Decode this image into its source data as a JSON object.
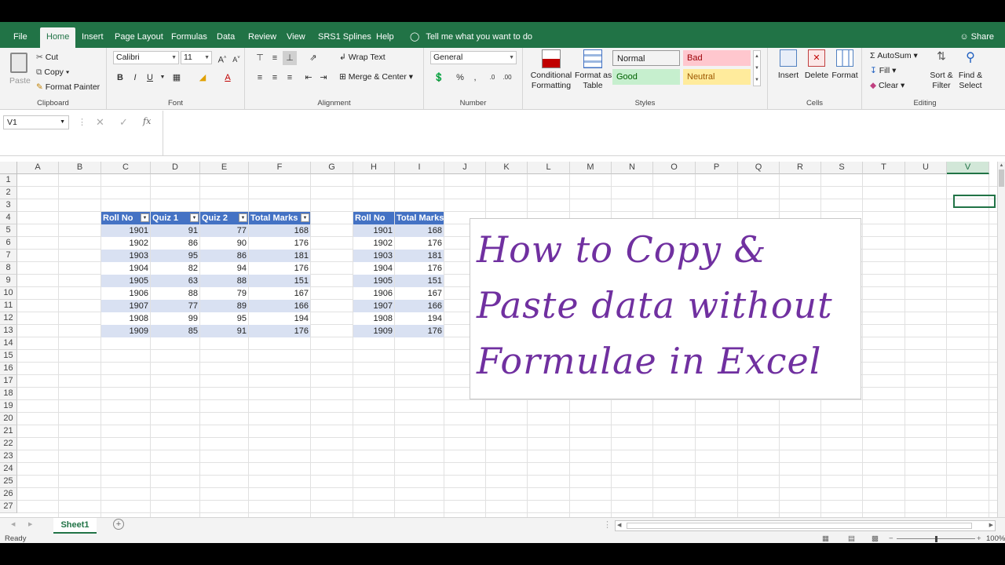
{
  "ribbon_tabs": [
    {
      "label": "File",
      "active": false
    },
    {
      "label": "Home",
      "active": true
    },
    {
      "label": "Insert",
      "active": false
    },
    {
      "label": "Page Layout",
      "active": false
    },
    {
      "label": "Formulas",
      "active": false
    },
    {
      "label": "Data",
      "active": false
    },
    {
      "label": "Review",
      "active": false
    },
    {
      "label": "View",
      "active": false
    },
    {
      "label": "SRS1 Splines",
      "active": false
    },
    {
      "label": "Help",
      "active": false
    }
  ],
  "tell_me": "Tell me what you want to do",
  "share": "Share",
  "clipboard": {
    "paste": "Paste",
    "cut": "Cut",
    "copy": "Copy",
    "format_painter": "Format Painter",
    "label": "Clipboard"
  },
  "font": {
    "name": "Calibri",
    "size": "11",
    "bold": "B",
    "italic": "I",
    "underline": "U",
    "label": "Font"
  },
  "alignment": {
    "wrap_text": "Wrap Text",
    "merge_center": "Merge & Center",
    "label": "Alignment"
  },
  "number": {
    "format": "General",
    "label": "Number"
  },
  "styles": {
    "conditional_formatting": [
      "Conditional",
      "Formatting"
    ],
    "format_as_table": [
      "Format as",
      "Table"
    ],
    "cells": [
      {
        "name": "Normal",
        "bg": "#ffffff",
        "fg": "#000000"
      },
      {
        "name": "Bad",
        "bg": "#ffc7ce",
        "fg": "#9c0006"
      },
      {
        "name": "Good",
        "bg": "#c6efce",
        "fg": "#006100"
      },
      {
        "name": "Neutral",
        "bg": "#ffeb9c",
        "fg": "#9c5700"
      }
    ],
    "label": "Styles"
  },
  "cells_group": {
    "insert": "Insert",
    "delete": "Delete",
    "format": "Format",
    "label": "Cells"
  },
  "editing": {
    "autosum": "AutoSum",
    "fill": "Fill",
    "clear": "Clear",
    "sort_filter": [
      "Sort &",
      "Filter"
    ],
    "find_select": [
      "Find &",
      "Select"
    ],
    "label": "Editing"
  },
  "name_box": "V1",
  "fx": "fx",
  "columns": [
    "A",
    "B",
    "C",
    "D",
    "E",
    "F",
    "G",
    "H",
    "I",
    "J",
    "K",
    "L",
    "M",
    "N",
    "O",
    "P",
    "Q",
    "R",
    "S",
    "T",
    "U",
    "V"
  ],
  "selected_column": "V",
  "rows": [
    "1",
    "2",
    "3",
    "4",
    "5",
    "6",
    "7",
    "8",
    "9",
    "10",
    "11",
    "12",
    "13",
    "14",
    "15",
    "16",
    "17",
    "18",
    "19",
    "20",
    "21",
    "22",
    "23",
    "24",
    "25",
    "26",
    "27"
  ],
  "table1": {
    "headers": [
      "Roll No",
      "Quiz 1",
      "Quiz 2",
      "Total Marks"
    ],
    "rows": [
      [
        "1901",
        "91",
        "77",
        "168"
      ],
      [
        "1902",
        "86",
        "90",
        "176"
      ],
      [
        "1903",
        "95",
        "86",
        "181"
      ],
      [
        "1904",
        "82",
        "94",
        "176"
      ],
      [
        "1905",
        "63",
        "88",
        "151"
      ],
      [
        "1906",
        "88",
        "79",
        "167"
      ],
      [
        "1907",
        "77",
        "89",
        "166"
      ],
      [
        "1908",
        "99",
        "95",
        "194"
      ],
      [
        "1909",
        "85",
        "91",
        "176"
      ]
    ]
  },
  "table2": {
    "headers": [
      "Roll No",
      "Total Marks"
    ],
    "rows": [
      [
        "1901",
        "168"
      ],
      [
        "1902",
        "176"
      ],
      [
        "1903",
        "181"
      ],
      [
        "1904",
        "176"
      ],
      [
        "1905",
        "151"
      ],
      [
        "1906",
        "167"
      ],
      [
        "1907",
        "166"
      ],
      [
        "1908",
        "194"
      ],
      [
        "1909",
        "176"
      ]
    ]
  },
  "textbox_lines": [
    "How to Copy &",
    "Paste data without",
    "Formulae in Excel"
  ],
  "accent_color": "#217346",
  "table_header_color": "#4472c4",
  "table_band_color": "#d9e1f2",
  "textbox_color": "#7030a0",
  "sheet_tab": "Sheet1",
  "status": "Ready",
  "zoom": "100%"
}
